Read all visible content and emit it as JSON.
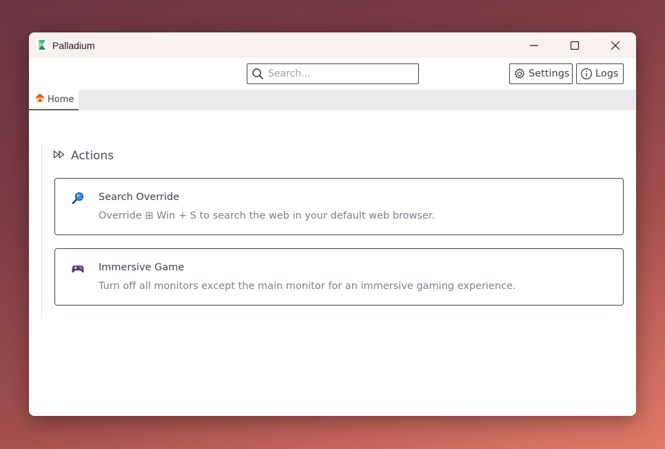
{
  "window": {
    "title": "Palladium",
    "controls": [
      "minimize",
      "maximize",
      "close"
    ]
  },
  "toolbar": {
    "search_placeholder": "Search...",
    "settings_label": "Settings",
    "logs_label": "Logs"
  },
  "tabs": [
    {
      "icon": "house-icon",
      "label": "Home"
    }
  ],
  "section": {
    "icon": "fast-forward-icon",
    "title": "Actions"
  },
  "actions": [
    {
      "icon": "magnifying-glass-emoji-icon",
      "title": "Search Override",
      "description": "Override ⊞ Win + S to search the web in your default web browser."
    },
    {
      "icon": "game-controller-emoji-icon",
      "title": "Immersive Game",
      "description": "Turn off all monitors except the main monitor for an immersive gaming experience."
    }
  ],
  "colors": {
    "accent_text": "#3d4150",
    "muted_text": "#7d808c",
    "titlebar_bg": "#f9f0f0",
    "tabbar_bg": "#ebebed",
    "logo_green": "#2fbf71"
  }
}
